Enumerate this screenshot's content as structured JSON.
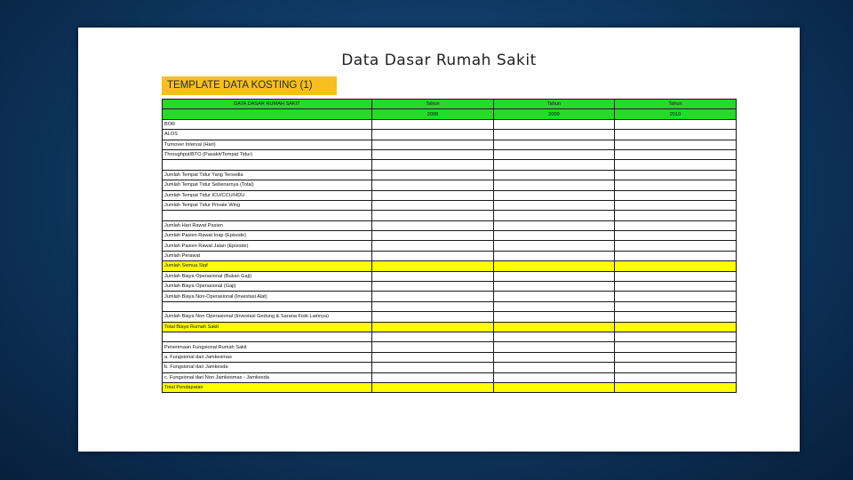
{
  "slide": {
    "title": "Data Dasar Rumah Sakit",
    "tag": "TEMPLATE DATA KOSTING (1)"
  },
  "table": {
    "header_label": "DATA DASAR RUMAH SAKIT",
    "year_label": "Tahun",
    "years": [
      "2008",
      "2009",
      "2010"
    ],
    "rows": [
      {
        "label": "BOR",
        "highlight": false
      },
      {
        "label": "ALOS",
        "highlight": false
      },
      {
        "label": "Turnover Interval (Hari)",
        "highlight": false
      },
      {
        "label": "Throughput/BTO (Pasakit/Tempat Tidur)",
        "highlight": false
      },
      {
        "label": "",
        "highlight": false
      },
      {
        "label": "Jumlah Tempat Tidur Yang Tersedia",
        "highlight": false
      },
      {
        "label": "Jumlah Tempat Tidur Sebenarnya (Total)",
        "highlight": false
      },
      {
        "label": "Jumlah Tempat Tidur ICU/CCU/HDU",
        "highlight": false
      },
      {
        "label": "Jumlah Tempat Tidur Private Wing",
        "highlight": false
      },
      {
        "label": "",
        "highlight": false
      },
      {
        "label": "Jumlah Hari Rawat Pasien",
        "highlight": false
      },
      {
        "label": "Jumlah Pasien Rawat Inap (Episode)",
        "highlight": false
      },
      {
        "label": "Jumlah Pasien Rawat Jalan (Episode)",
        "highlight": false
      },
      {
        "label": "Jumlah Perawat",
        "highlight": false
      },
      {
        "label": "Jumlah Semua Staf",
        "highlight": true
      },
      {
        "label": "Jumlah Biaya Operasional (Bukan Gaji)",
        "highlight": false
      },
      {
        "label": "Jumlah Biaya Operasional (Gaji)",
        "highlight": false
      },
      {
        "label": "Jumlah Biaya Non-Operasional (Investasi Alat)",
        "highlight": false
      },
      {
        "label": "",
        "highlight": false
      },
      {
        "label": "Jumlah Biaya Non Operasional (Investasi Gedung & Sarana Fisik Lainnya)",
        "highlight": false
      },
      {
        "label": "Total Biaya Rumah Sakit",
        "highlight": true
      },
      {
        "label": "",
        "highlight": false
      },
      {
        "label": "Penerimaan Fungsional Rumah Sakit",
        "highlight": false
      },
      {
        "label": "a. Fungsional dari Jamkesmas",
        "highlight": false
      },
      {
        "label": "b. Fungsional dari Jamkesda",
        "highlight": false
      },
      {
        "label": "c. Fungsional dari Non Jamkesmas - Jamkesda",
        "highlight": false
      },
      {
        "label": "Total Pendapatan",
        "highlight": true
      }
    ]
  },
  "colors": {
    "header_green": "#22dd22",
    "highlight_yellow": "#ffff00",
    "tag_orange": "#f6bf1d",
    "background_blue": "#0f3b66"
  }
}
